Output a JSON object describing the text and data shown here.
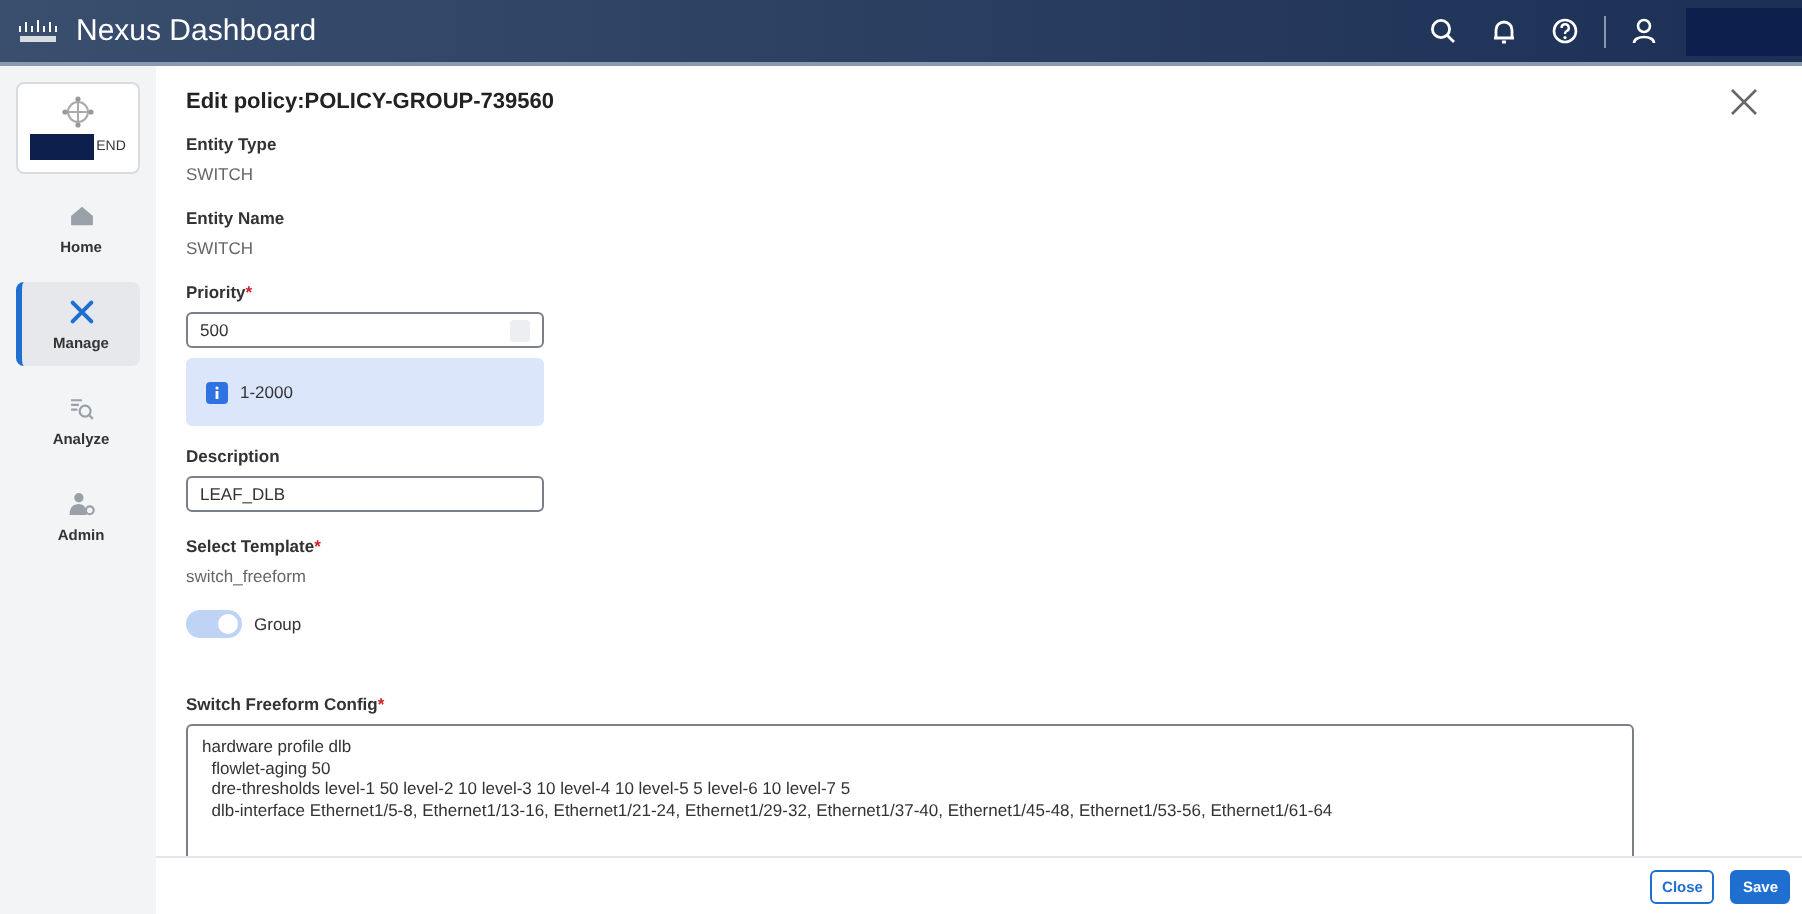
{
  "header": {
    "brand": "Nexus Dashboard"
  },
  "sidebar": {
    "site": {
      "suffix": "END"
    },
    "items": [
      {
        "label": "Home",
        "selected": false
      },
      {
        "label": "Manage",
        "selected": true
      },
      {
        "label": "Analyze",
        "selected": false
      },
      {
        "label": "Admin",
        "selected": false
      }
    ]
  },
  "dialog": {
    "title": "Edit policy:POLICY-GROUP-739560",
    "fields": [
      {
        "kind": "static",
        "label": "Entity Type",
        "value": "SWITCH"
      },
      {
        "kind": "static",
        "label": "Entity Name",
        "value": "SWITCH"
      },
      {
        "kind": "number",
        "label": "Priority",
        "required_mark": "*",
        "value": "500",
        "hint": "1-2000"
      },
      {
        "kind": "text",
        "label": "Description",
        "value": "LEAF_DLB"
      },
      {
        "kind": "static",
        "label": "Select Template",
        "required_mark": "*",
        "value": "switch_freeform"
      },
      {
        "kind": "toggle",
        "label": "Group",
        "on": true,
        "disabled": true
      },
      {
        "kind": "textarea",
        "label": "Switch Freeform Config",
        "required_mark": "*",
        "lines": [
          "hardware profile dlb",
          "  flowlet-aging 50",
          "  dre-thresholds level-1 50 level-2 10 level-3 10 level-4 10 level-5 5 level-6 10 level-7 5",
          "  dlb-interface Ethernet1/5-8, Ethernet1/13-16, Ethernet1/21-24, Ethernet1/29-32, Ethernet1/37-40, Ethernet1/45-48, Ethernet1/53-56, Ethernet1/61-64"
        ]
      }
    ],
    "buttons": [
      {
        "label": "Close",
        "kind": "secondary"
      },
      {
        "label": "Save",
        "kind": "primary"
      }
    ]
  }
}
